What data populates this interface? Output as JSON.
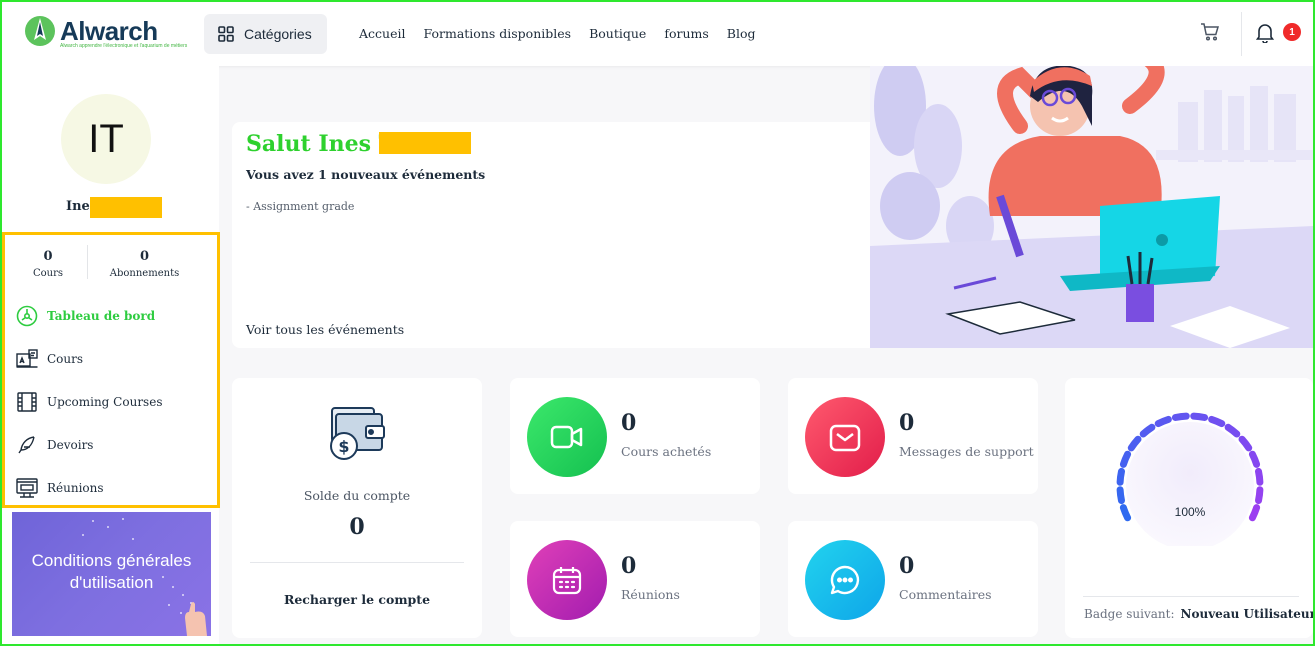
{
  "header": {
    "logo_name": "Alwarch",
    "logo_tagline": "Alwarch apprendre l'électronique et l'aquarium de métiers",
    "categories_label": "Catégories",
    "nav": [
      "Accueil",
      "Formations disponibles",
      "Boutique",
      "forums",
      "Blog"
    ],
    "notification_count": "1"
  },
  "sidebar": {
    "avatar_initials": "IT",
    "user_name": "Ines",
    "stats": [
      {
        "value": "0",
        "label": "Cours"
      },
      {
        "value": "0",
        "label": "Abonnements"
      }
    ],
    "menu": [
      {
        "label": "Tableau de bord",
        "icon": "dashboard-icon",
        "active": true
      },
      {
        "label": "Cours",
        "icon": "courses-icon"
      },
      {
        "label": "Upcoming Courses",
        "icon": "film-icon"
      },
      {
        "label": "Devoirs",
        "icon": "feather-icon"
      },
      {
        "label": "Réunions",
        "icon": "meeting-icon"
      }
    ],
    "promo_text": "Conditions générales d'utilisation"
  },
  "welcome": {
    "greeting": "Salut Ines T",
    "events_count": "Vous avez 1 nouveaux événements",
    "event_item": "- Assignment grade",
    "see_all": "Voir tous les événements"
  },
  "balance": {
    "title": "Solde du compte",
    "value": "0",
    "action": "Recharger le compte"
  },
  "stats_cards": [
    {
      "value": "0",
      "label": "Cours achetés",
      "icon": "video-icon",
      "color": "#22c55e"
    },
    {
      "value": "0",
      "label": "Messages de support",
      "icon": "mail-icon",
      "color": "#f43f5e"
    },
    {
      "value": "0",
      "label": "Réunions",
      "icon": "calendar-icon",
      "color": "#c026d3"
    },
    {
      "value": "0",
      "label": "Commentaires",
      "icon": "comment-icon",
      "color": "#0ea5e9"
    }
  ],
  "badge": {
    "progress": 100,
    "progress_label": "100%",
    "next_label": "Badge suivant:",
    "next_value": "Nouveau Utilisateur"
  },
  "colors": {
    "accent_green": "#2ecc40",
    "highlight_yellow": "#ffc000",
    "frame_green": "#2ee82e"
  }
}
